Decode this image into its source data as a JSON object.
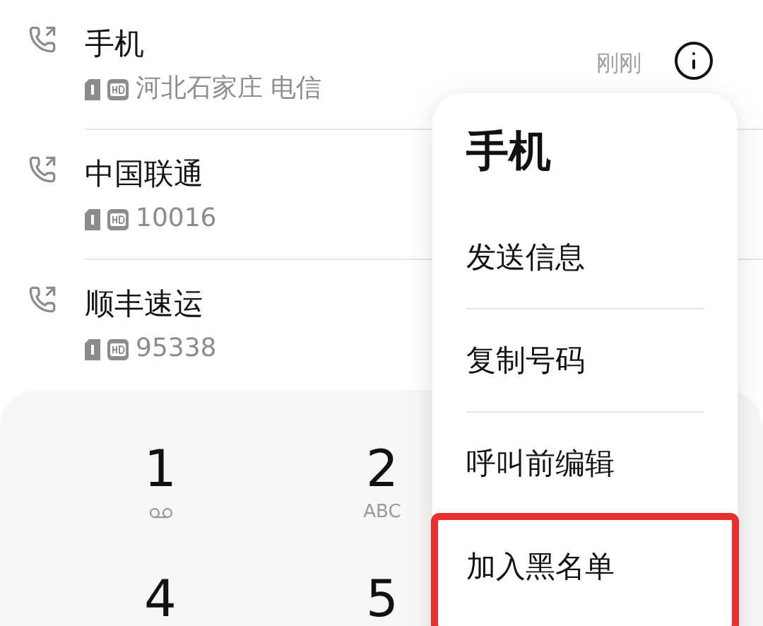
{
  "calls": [
    {
      "name": "手机",
      "detail": "河北石家庄 电信",
      "time": "刚刚",
      "info": true
    },
    {
      "name": "中国联通",
      "detail": "10016"
    },
    {
      "name": "顺丰速运",
      "detail": "95338"
    }
  ],
  "dialpad": {
    "keys": [
      {
        "digit": "1",
        "kind": "voicemail"
      },
      {
        "digit": "2",
        "kind": "letters",
        "letters": "ABC"
      },
      {
        "digit": "4",
        "kind": "plain"
      },
      {
        "digit": "5",
        "kind": "plain"
      }
    ]
  },
  "menu": {
    "title": "手机",
    "items": [
      {
        "label": "发送信息",
        "highlighted": false
      },
      {
        "label": "复制号码",
        "highlighted": false
      },
      {
        "label": "呼叫前编辑",
        "highlighted": false
      },
      {
        "label": "加入黑名单",
        "highlighted": true
      }
    ]
  }
}
